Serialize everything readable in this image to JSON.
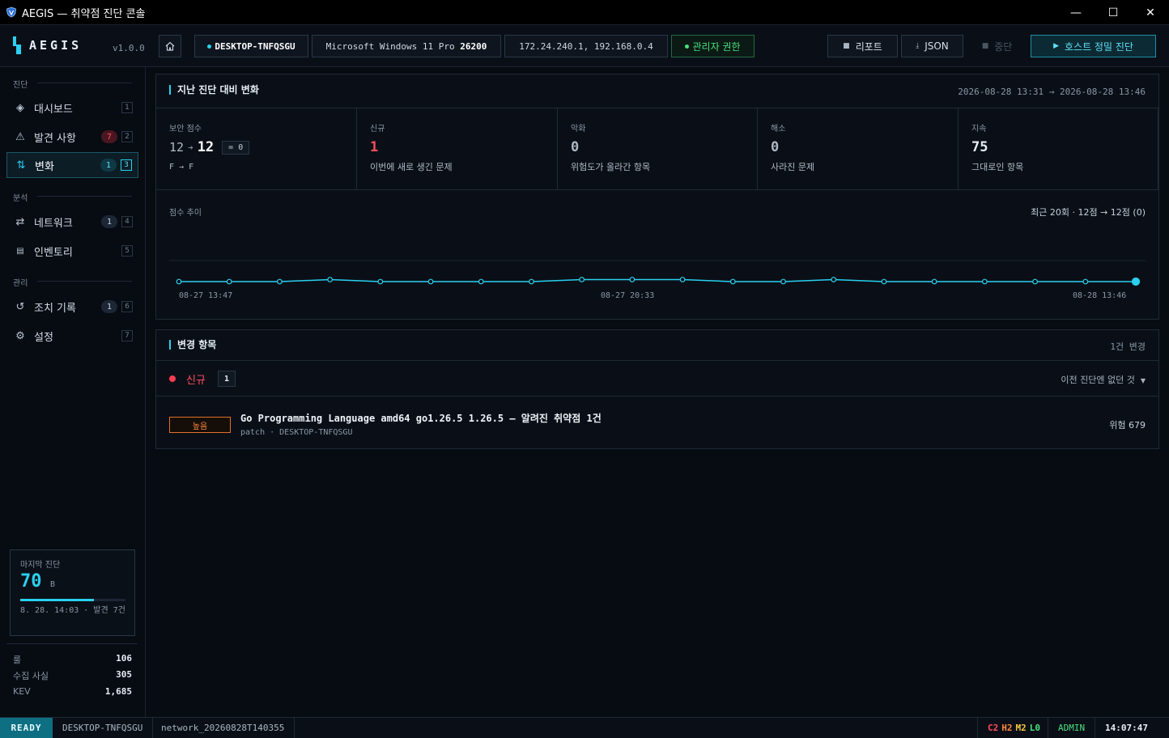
{
  "window": {
    "title": "AEGIS — 취약점 진단 콘솔",
    "controls": [
      "—",
      "☐",
      "✕"
    ]
  },
  "header": {
    "logo": "AEGIS",
    "version": "v1.0.0",
    "hostname": "DESKTOP-TNFQSGU",
    "os_name": "Microsoft Windows 11 Pro",
    "os_build": "26200",
    "ips": "172.24.240.1, 192.168.0.4",
    "privilege": "관리자 권한",
    "btn_report": "리포트",
    "btn_json": "JSON",
    "btn_stop": "중단",
    "btn_scan": "호스트 정밀 진단",
    "icons": {
      "report": "report-icon",
      "json": "download-icon",
      "stop": "stop-icon",
      "scan": "play-icon",
      "home": "home-icon"
    }
  },
  "sidebar": {
    "sections": [
      {
        "label": "진단"
      },
      {
        "label": "분석"
      },
      {
        "label": "관리"
      }
    ],
    "items": [
      {
        "label": "대시보드",
        "icon": "◈",
        "key": "1"
      },
      {
        "label": "발견 사항",
        "icon": "⚠",
        "badge": "7",
        "key": "2"
      },
      {
        "label": "변화",
        "icon": "⇅",
        "badge": "1",
        "key": "3"
      },
      {
        "label": "네트워크",
        "icon": "⇄",
        "badge": "1",
        "key": "4"
      },
      {
        "label": "인벤토리",
        "icon": "▤",
        "key": "5"
      },
      {
        "label": "조치 기록",
        "icon": "↺",
        "badge": "1",
        "key": "6"
      },
      {
        "label": "설정",
        "icon": "⚙",
        "key": "7"
      }
    ],
    "last_scan": {
      "label": "마지막 진단",
      "score": "70",
      "grade": "B",
      "progress": 0.7,
      "meta": "8. 28. 14:03 · 발견 7건"
    },
    "stats": [
      {
        "k": "룰",
        "v": "106"
      },
      {
        "k": "수집 사실",
        "v": "305"
      },
      {
        "k": "KEV",
        "v": "1,685"
      }
    ]
  },
  "diff_panel": {
    "title": "지난 진단 대비 변화",
    "range": "2026-08-28 13:31 → 2026-08-28 13:46",
    "kpis": {
      "score_label": "보안 점수",
      "score_from": "12",
      "score_to": "12",
      "score_delta": "= 0",
      "grade_change": "F → F",
      "new_label": "신규",
      "new_value": "1",
      "new_sub": "이번에 새로 생긴 문제",
      "worse_label": "악화",
      "worse_value": "0",
      "worse_sub": "위험도가 올라간 항목",
      "resolved_label": "해소",
      "resolved_value": "0",
      "resolved_sub": "사라진 문제",
      "persist_label": "지속",
      "persist_value": "75",
      "persist_sub": "그대로인 항목"
    },
    "trend_label": "점수 추이",
    "trend_meta": "최근 20회 · 12점 → 12점 (0)"
  },
  "chart_data": {
    "type": "line",
    "x_ticks": [
      "08-27 13:47",
      "08-27 20:33",
      "08-28 13:46"
    ],
    "values": [
      12,
      12,
      12,
      13,
      12,
      12,
      12,
      12,
      13,
      13,
      13,
      12,
      12,
      13,
      12,
      12,
      12,
      12,
      12,
      12
    ],
    "ylim": [
      0,
      100
    ],
    "grid": false,
    "color": "#2ad0ee"
  },
  "changes_panel": {
    "title": "변경 항목",
    "count": "1건 변경",
    "group_label": "신규",
    "group_count": "1",
    "sort_label": "이전 진단엔 없던 것",
    "items": [
      {
        "severity": "높음",
        "title": "Go Programming Language amd64 go1.26.5 1.26.5 — 알려진 취약점 1건",
        "sub": "patch · DESKTOP-TNFQSGU",
        "risk": "위험 679"
      }
    ]
  },
  "statusbar": {
    "state": "READY",
    "host": "DESKTOP-TNFQSGU",
    "scan_id": "network_20260828T140355",
    "sev_c": "C2",
    "sev_h": "H2",
    "sev_m": "M2",
    "sev_l": "L0",
    "role": "ADMIN",
    "clock": "14:07:47"
  },
  "colors": {
    "accent": "#2ad0ee",
    "critical": "#ff4d5e",
    "high": "#ff8a3d",
    "medium": "#f5c542",
    "low": "#4ae07f"
  }
}
